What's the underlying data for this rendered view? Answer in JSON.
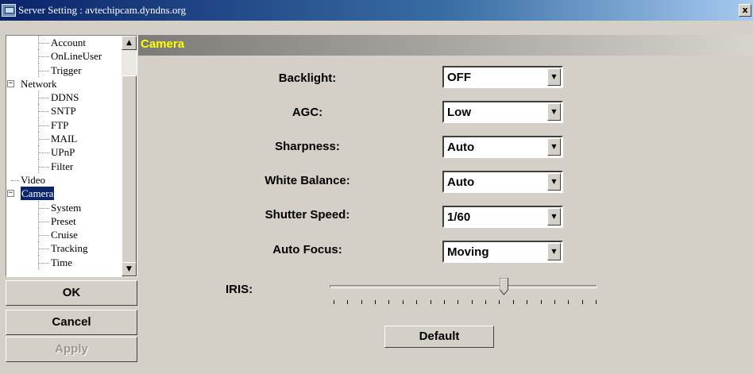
{
  "window": {
    "title": "Server Setting : avtechipcam.dyndns.org",
    "close_glyph": "x"
  },
  "tree": {
    "rows": [
      {
        "label": "Account",
        "kind": "child"
      },
      {
        "label": "OnLineUser",
        "kind": "child"
      },
      {
        "label": "Trigger",
        "kind": "child"
      },
      {
        "label": "Network",
        "kind": "parent",
        "expander": "−"
      },
      {
        "label": "DDNS",
        "kind": "child"
      },
      {
        "label": "SNTP",
        "kind": "child"
      },
      {
        "label": "FTP",
        "kind": "child"
      },
      {
        "label": "MAIL",
        "kind": "child"
      },
      {
        "label": "UPnP",
        "kind": "child"
      },
      {
        "label": "Filter",
        "kind": "child"
      },
      {
        "label": "Video",
        "kind": "leaf"
      },
      {
        "label": "Camera",
        "kind": "parent",
        "expander": "−",
        "selected": true
      },
      {
        "label": "System",
        "kind": "child"
      },
      {
        "label": "Preset",
        "kind": "child"
      },
      {
        "label": "Cruise",
        "kind": "child"
      },
      {
        "label": "Tracking",
        "kind": "child"
      },
      {
        "label": "Time",
        "kind": "child"
      }
    ],
    "scroll_up_glyph": "▲",
    "scroll_down_glyph": "▼"
  },
  "buttons": {
    "ok": "OK",
    "cancel": "Cancel",
    "apply": "Apply",
    "default": "Default"
  },
  "section": {
    "title": "Camera"
  },
  "settings": [
    {
      "label": "Backlight:",
      "value": "OFF"
    },
    {
      "label": "AGC:",
      "value": "Low"
    },
    {
      "label": "Sharpness:",
      "value": "Auto"
    },
    {
      "label": "White Balance:",
      "value": "Auto"
    },
    {
      "label": "Shutter Speed:",
      "value": "1/60"
    },
    {
      "label": "Auto Focus:",
      "value": "Moving"
    }
  ],
  "dropdown_arrow_glyph": "▼",
  "iris": {
    "label": "IRIS:",
    "level": 0.65,
    "tick_count": 20
  },
  "colors": {
    "title_bar": "#0a246a",
    "section_title": "#ffff00",
    "selection": "#0a246a",
    "face": "#d4d0c8"
  }
}
